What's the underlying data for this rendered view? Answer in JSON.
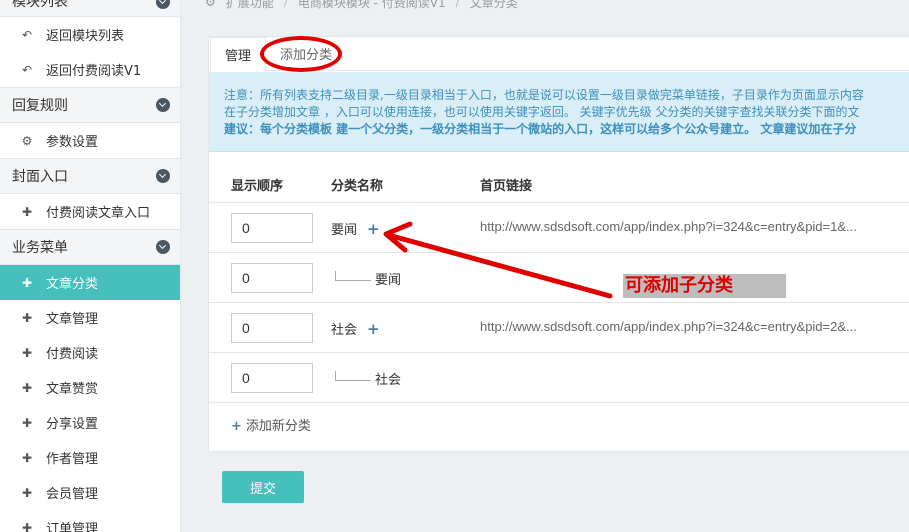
{
  "sidebar": {
    "sections": [
      {
        "title": "模块列表",
        "items": [
          {
            "label": "返回模块列表",
            "icon": "back-arrow-icon"
          },
          {
            "label": "返回付费阅读V1",
            "icon": "back-arrow-icon"
          }
        ]
      },
      {
        "title": "回复规则",
        "items": [
          {
            "label": "参数设置",
            "icon": "gear-icon"
          }
        ]
      },
      {
        "title": "封面入口",
        "items": [
          {
            "label": "付费阅读文章入口",
            "icon": "puzzle-icon"
          }
        ]
      },
      {
        "title": "业务菜单",
        "items": [
          {
            "label": "文章分类",
            "icon": "puzzle-icon"
          },
          {
            "label": "文章管理",
            "icon": "puzzle-icon"
          },
          {
            "label": "付费阅读",
            "icon": "puzzle-icon"
          },
          {
            "label": "文章赞赏",
            "icon": "puzzle-icon"
          },
          {
            "label": "分享设置",
            "icon": "puzzle-icon"
          },
          {
            "label": "作者管理",
            "icon": "puzzle-icon"
          },
          {
            "label": "会员管理",
            "icon": "puzzle-icon"
          },
          {
            "label": "订单管理",
            "icon": "puzzle-icon"
          }
        ]
      }
    ]
  },
  "breadcrumb": [
    "扩展功能",
    "电商模块模块 - 付费阅读V1",
    "文章分类"
  ],
  "tabs": [
    "管理",
    "添加分类"
  ],
  "notice": {
    "line1": "注意：所有列表支持二级目录,一级目录相当于入口，也就是说可以设置一级目录做完菜单链接，子目录作为页面显示内容",
    "line2": "在子分类增加文章 ，入口可以使用连接，也可以使用关键字返回。 关键字优先级 父分类的关键字查找关联分类下面的文",
    "line3": "建议：每个分类模板 建一个父分类，一级分类相当于一个微站的入口，这样可以给多个公众号建立。 文章建议加在子分"
  },
  "table": {
    "headers": [
      "显示顺序",
      "分类名称",
      "首页链接"
    ],
    "rows": [
      {
        "order": "0",
        "name": "要闻",
        "child": false,
        "link": "http://www.sdsdsoft.com/app/index.php?i=324&c=entry&pid=1&..."
      },
      {
        "order": "0",
        "name": "要闻",
        "child": true,
        "link": ""
      },
      {
        "order": "0",
        "name": "社会",
        "child": false,
        "link": "http://www.sdsdsoft.com/app/index.php?i=324&c=entry&pid=2&..."
      },
      {
        "order": "0",
        "name": "社会",
        "child": true,
        "link": ""
      }
    ],
    "add_label": "添加新分类"
  },
  "submit_label": "提交",
  "annotation_text": "可添加子分类",
  "colors": {
    "accent": "#46c0bd",
    "annotation": "#e00000",
    "notice_bg": "#daeef7"
  }
}
